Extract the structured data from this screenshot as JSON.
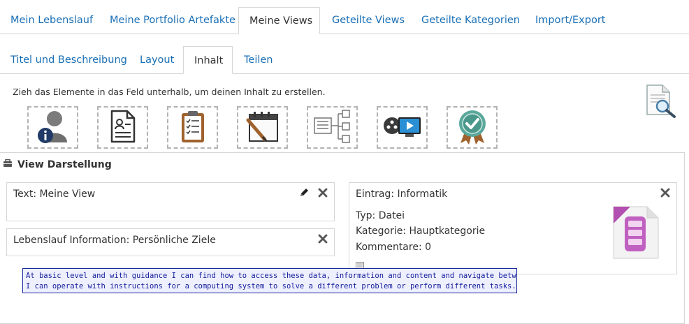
{
  "main_tabs": [
    {
      "label": "Mein Lebenslauf",
      "active": false
    },
    {
      "label": "Meine Portfolio Artefakte",
      "active": false
    },
    {
      "label": "Meine Views",
      "active": true
    },
    {
      "label": "Geteilte Views",
      "active": false
    },
    {
      "label": "Geteilte Kategorien",
      "active": false
    },
    {
      "label": "Import/Export",
      "active": false
    }
  ],
  "sub_tabs": [
    {
      "label": "Titel und Beschreibung",
      "active": false
    },
    {
      "label": "Layout",
      "active": false
    },
    {
      "label": "Inhalt",
      "active": true
    },
    {
      "label": "Teilen",
      "active": false
    }
  ],
  "instruction": "Zieh das Elemente in das Feld unterhalb, um deinen Inhalt zu erstellen.",
  "blocks": [
    {
      "icon": "profile-info-icon"
    },
    {
      "icon": "cv-document-icon"
    },
    {
      "icon": "clipboard-checklist-icon"
    },
    {
      "icon": "calendar-pen-icon"
    },
    {
      "icon": "text-tree-icon"
    },
    {
      "icon": "media-video-icon"
    },
    {
      "icon": "badge-check-icon"
    }
  ],
  "view": {
    "title": "View Darstellung",
    "panels": {
      "text": {
        "title": "Text: Meine View"
      },
      "cv": {
        "title": "Lebenslauf Information: Persönliche Ziele"
      },
      "entry": {
        "title": "Eintrag: Informatik",
        "type": "Typ: Datei",
        "category": "Kategorie: Hauptkategorie",
        "comments": "Kommentare: 0"
      }
    }
  },
  "tooltip": {
    "line1": "At basic level and with guidance I can find how to access these data, information and content and navigate between them.",
    "line2": "I can operate with instructions for a computing system to solve a different problem or perform different tasks."
  },
  "colors": {
    "link": "#1a6fb5",
    "border": "#d6d6d6",
    "tooltip_bg": "#eef0ff",
    "tooltip_text": "#111a99"
  }
}
